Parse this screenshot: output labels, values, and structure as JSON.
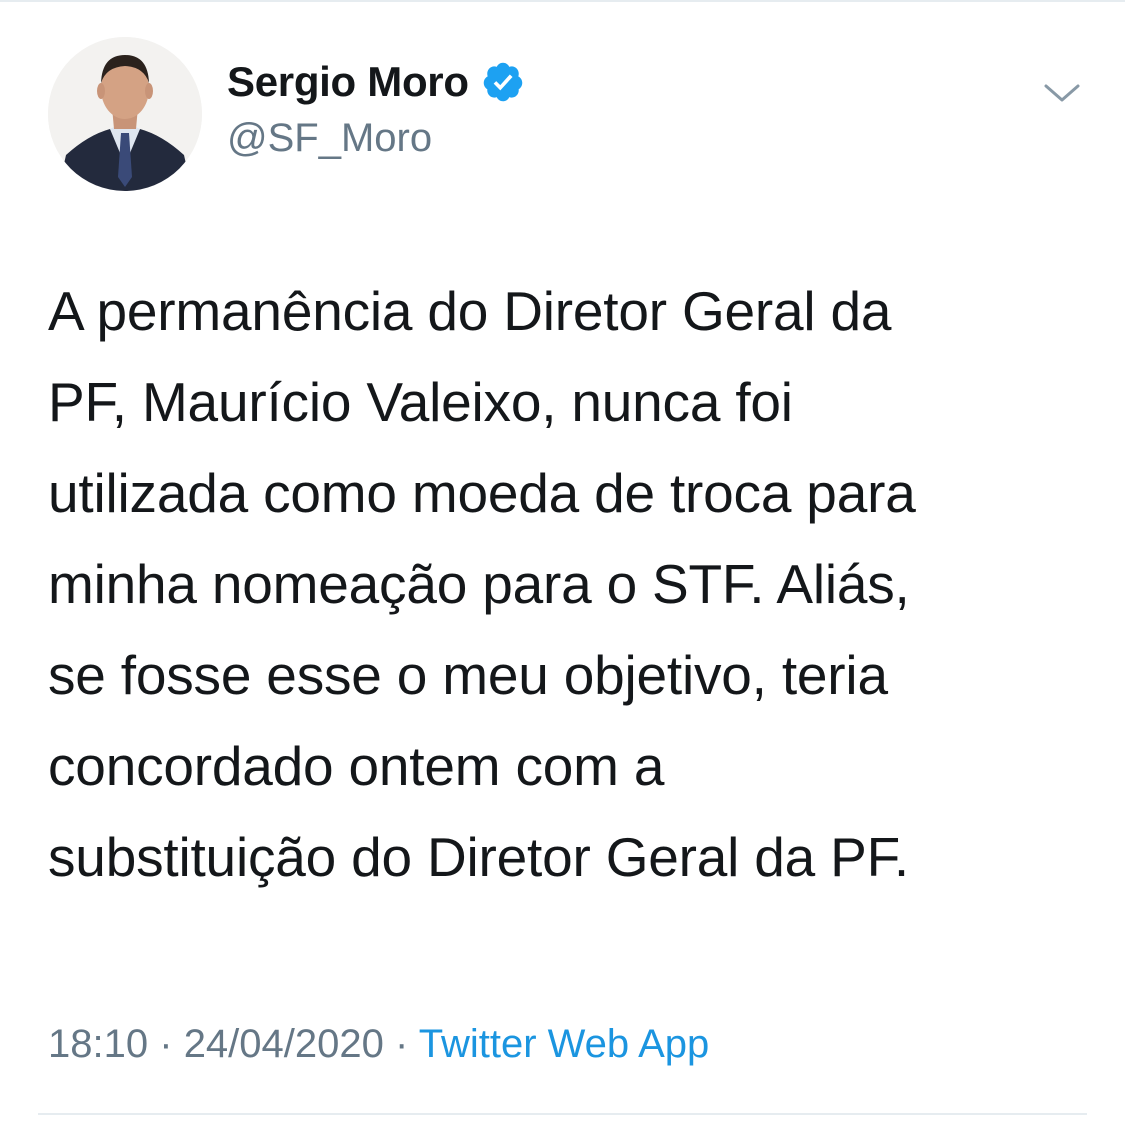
{
  "author": {
    "name": "Sergio Moro",
    "handle": "@SF_Moro",
    "verified": true
  },
  "icons": {
    "avatar": "profile-photo",
    "verified": "verified-badge-icon",
    "menu": "chevron-down-icon"
  },
  "tweet": {
    "lines": [
      "A permanência do Diretor Geral da",
      "PF, Maurício Valeixo, nunca foi",
      "utilizada como moeda de troca para",
      "minha nomeação para o STF. Aliás,",
      "se fosse esse o meu objetivo, teria",
      "concordado ontem com a",
      "substituição do Diretor Geral da PF."
    ]
  },
  "meta": {
    "time": "18:10",
    "separator": "·",
    "date": "24/04/2020",
    "source": "Twitter Web App"
  },
  "colors": {
    "text": "#14171a",
    "secondary": "#657786",
    "accent": "#1b95e0",
    "verified": "#1da1f2",
    "divider": "#e6ecf0"
  }
}
